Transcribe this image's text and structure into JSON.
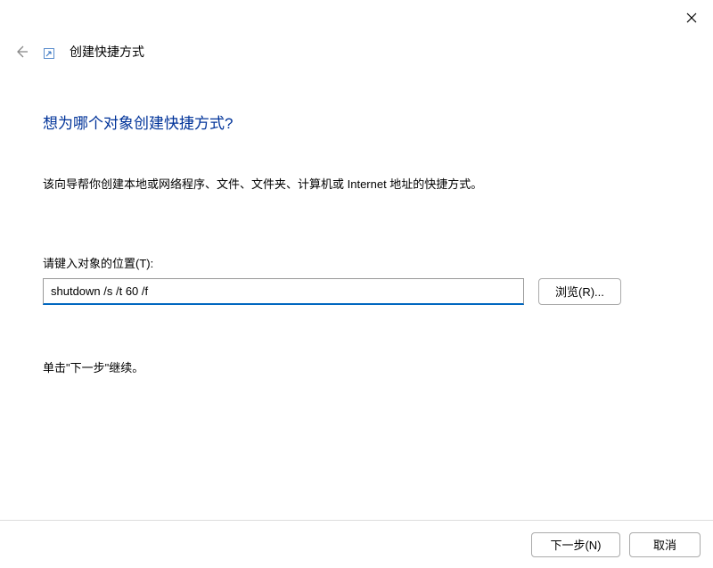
{
  "header": {
    "wizard_title": "创建快捷方式"
  },
  "main": {
    "heading": "想为哪个对象创建快捷方式?",
    "description": "该向导帮你创建本地或网络程序、文件、文件夹、计算机或 Internet 地址的快捷方式。",
    "location_label": "请键入对象的位置(T):",
    "location_value": "shutdown /s /t 60 /f",
    "browse_label": "浏览(R)...",
    "continue_hint": "单击\"下一步\"继续。"
  },
  "footer": {
    "next_label": "下一步(N)",
    "cancel_label": "取消"
  }
}
